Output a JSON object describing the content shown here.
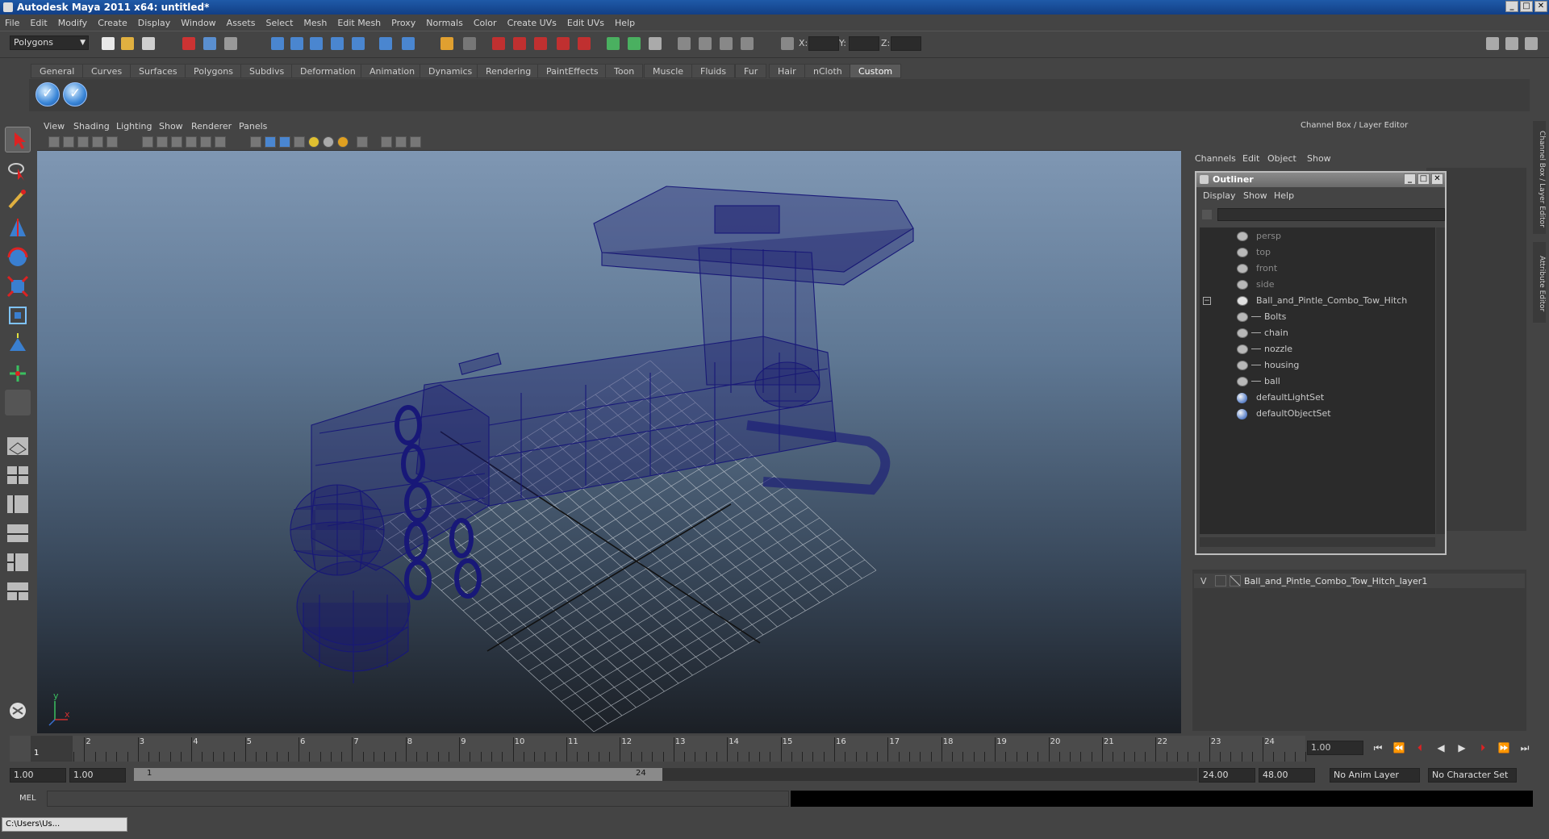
{
  "window": {
    "title": "Autodesk Maya 2011 x64: untitled*"
  },
  "menubar": [
    "File",
    "Edit",
    "Modify",
    "Create",
    "Display",
    "Window",
    "Assets",
    "Select",
    "Mesh",
    "Edit Mesh",
    "Proxy",
    "Normals",
    "Color",
    "Create UVs",
    "Edit UVs",
    "Help"
  ],
  "status_line": {
    "mode": "Polygons",
    "x_label": "X:",
    "y_label": "Y:",
    "z_label": "Z:"
  },
  "shelf": {
    "tabs": [
      "General",
      "Curves",
      "Surfaces",
      "Polygons",
      "Subdivs",
      "Deformation",
      "Animation",
      "Dynamics",
      "Rendering",
      "PaintEffects",
      "Toon",
      "Muscle",
      "Fluids",
      "Fur",
      "Hair",
      "nCloth",
      "Custom"
    ],
    "active_tab": "Custom"
  },
  "viewport": {
    "menus": [
      "View",
      "Shading",
      "Lighting",
      "Show",
      "Renderer",
      "Panels"
    ],
    "axis_y": "y",
    "axis_x": "x"
  },
  "channel_box": {
    "title": "Channel Box / Layer Editor",
    "menus": [
      "Channels",
      "Edit",
      "Object",
      "Show"
    ],
    "side_tab_1": "Channel Box / Layer Editor",
    "side_tab_2": "Attribute Editor"
  },
  "outliner": {
    "title": "Outliner",
    "menus": [
      "Display",
      "Show",
      "Help"
    ],
    "items": [
      {
        "label": "persp",
        "dim": true
      },
      {
        "label": "top",
        "dim": true
      },
      {
        "label": "front",
        "dim": true
      },
      {
        "label": "side",
        "dim": true
      },
      {
        "label": "Ball_and_Pintle_Combo_Tow_Hitch",
        "dim": false
      },
      {
        "label": "Bolts",
        "dim": false
      },
      {
        "label": "chain",
        "dim": false
      },
      {
        "label": "nozzle",
        "dim": false
      },
      {
        "label": "housing",
        "dim": false
      },
      {
        "label": "ball",
        "dim": false
      },
      {
        "label": "defaultLightSet",
        "dim": false
      },
      {
        "label": "defaultObjectSet",
        "dim": false
      }
    ]
  },
  "layer_editor": {
    "visible_flag": "V",
    "layer_name": "Ball_and_Pintle_Combo_Tow_Hitch_layer1"
  },
  "timeline": {
    "ticks": [
      "1",
      "2",
      "3",
      "4",
      "5",
      "6",
      "7",
      "8",
      "9",
      "10",
      "11",
      "12",
      "13",
      "14",
      "15",
      "16",
      "17",
      "18",
      "19",
      "20",
      "21",
      "22",
      "23",
      "24"
    ],
    "current_frame_marker": "1",
    "current_frame": "1.00"
  },
  "range": {
    "start": "1.00",
    "playback_start": "1.00",
    "slider_start": "1",
    "slider_end": "24",
    "playback_end": "24.00",
    "end": "48.00",
    "anim_layer": "No Anim Layer",
    "character_set": "No Character Set"
  },
  "command_line": {
    "label": "MEL"
  },
  "taskbar": {
    "item": "C:\\Users\\Us..."
  },
  "colors": {
    "wireframe": "#1a1a7a",
    "grid": "#c8c8c8"
  }
}
